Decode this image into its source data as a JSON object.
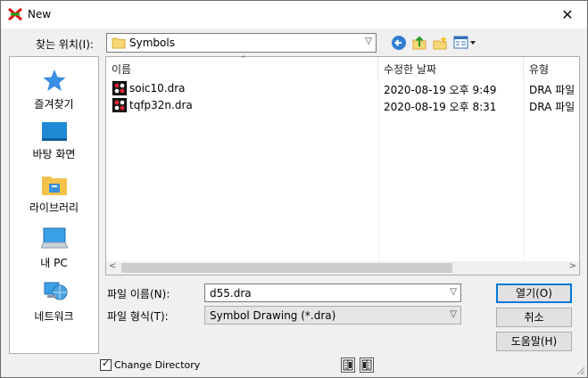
{
  "window": {
    "title": "New"
  },
  "lookin": {
    "label": "찾는 위치(I):",
    "value": "Symbols"
  },
  "places": [
    {
      "label": "즐겨찾기"
    },
    {
      "label": "바탕 화면"
    },
    {
      "label": "라이브러리"
    },
    {
      "label": "내 PC"
    },
    {
      "label": "네트워크"
    }
  ],
  "list": {
    "columns": [
      "이름",
      "수정한 날짜",
      "유형"
    ],
    "rows": [
      {
        "name": "soic10.dra",
        "date": "2020-08-19 오후 9:49",
        "type": "DRA 파일"
      },
      {
        "name": "tqfp32n.dra",
        "date": "2020-08-19 오후 8:31",
        "type": "DRA 파일"
      }
    ]
  },
  "filename": {
    "label": "파일 이름(N):",
    "value": "d55.dra"
  },
  "filetype": {
    "label": "파일 형식(T):",
    "value": "Symbol Drawing (*.dra)"
  },
  "buttons": {
    "open": "열기(O)",
    "cancel": "취소",
    "help": "도움말(H)"
  },
  "change_directory": {
    "label": "Change Directory",
    "checked": true
  }
}
